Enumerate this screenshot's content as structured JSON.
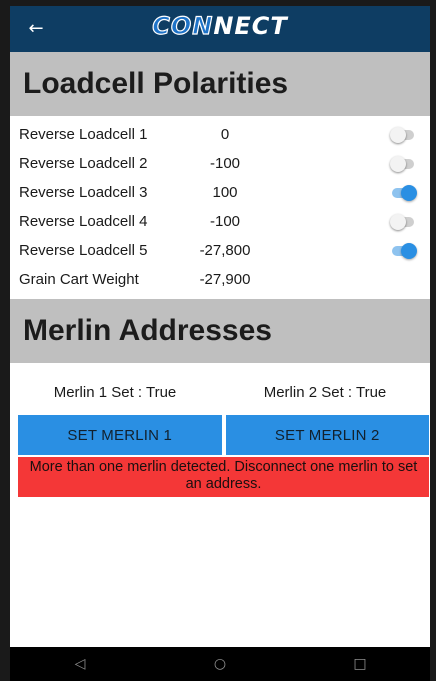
{
  "appbar": {
    "back_icon": "←",
    "logo_prefix": "CON",
    "logo_suffix": "NECT"
  },
  "polarities": {
    "title": "Loadcell Polarities",
    "rows": [
      {
        "label": "Reverse Loadcell 1",
        "value": "0",
        "toggle": false
      },
      {
        "label": "Reverse Loadcell 2",
        "value": "-100",
        "toggle": false
      },
      {
        "label": "Reverse Loadcell 3",
        "value": "100",
        "toggle": true
      },
      {
        "label": "Reverse Loadcell 4",
        "value": "-100",
        "toggle": false
      },
      {
        "label": "Reverse Loadcell 5",
        "value": "-27,800",
        "toggle": true
      }
    ],
    "total": {
      "label": "Grain Cart Weight",
      "value": "-27,900"
    }
  },
  "merlin": {
    "title": "Merlin Addresses",
    "status1": "Merlin 1 Set : True",
    "status2": "Merlin 2 Set : True",
    "button1": "SET MERLIN 1",
    "button2": "SET MERLIN 2",
    "error": "More than one merlin detected. Disconnect one merlin to set an address."
  },
  "navbar": {
    "back": "◁",
    "home": "○",
    "recents": "□"
  },
  "colors": {
    "appbar": "#0e3d63",
    "accent": "#2a8fe3",
    "error": "#f43737",
    "header_bg": "#bfbfbf"
  }
}
